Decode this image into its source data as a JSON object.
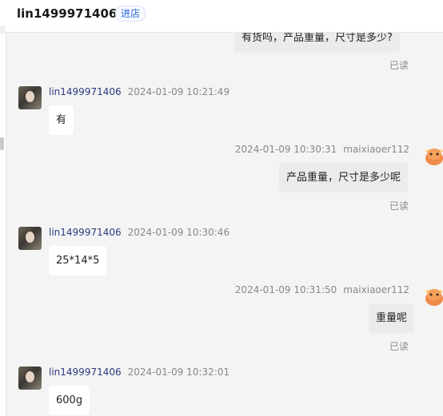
{
  "header": {
    "title": "lin1499971406",
    "store_button": "进店"
  },
  "contact_name": "lin1499971406",
  "shop_name": "maixiaoer112",
  "read_label": "已读",
  "messages": [
    {
      "side": "out",
      "text": "有货吗，产品重量，尺寸是多少?",
      "time": "",
      "read": true
    },
    {
      "side": "in",
      "text": "有",
      "time": "2024-01-09 10:21:49"
    },
    {
      "side": "out",
      "text": "产品重量，尺寸是多少呢",
      "time": "2024-01-09 10:30:31",
      "read": true
    },
    {
      "side": "in",
      "text": "25*14*5",
      "time": "2024-01-09 10:30:46"
    },
    {
      "side": "out",
      "text": "重量呢",
      "time": "2024-01-09 10:31:50",
      "read": true
    },
    {
      "side": "in",
      "text": "600g",
      "time": "2024-01-09 10:32:01"
    }
  ],
  "colors": {
    "background": "#f4f4f4",
    "incoming_bubble": "#ffffff",
    "outgoing_bubble": "#ebebeb",
    "sender_name": "#2c3a80",
    "store_button": "#2d6ad8"
  }
}
